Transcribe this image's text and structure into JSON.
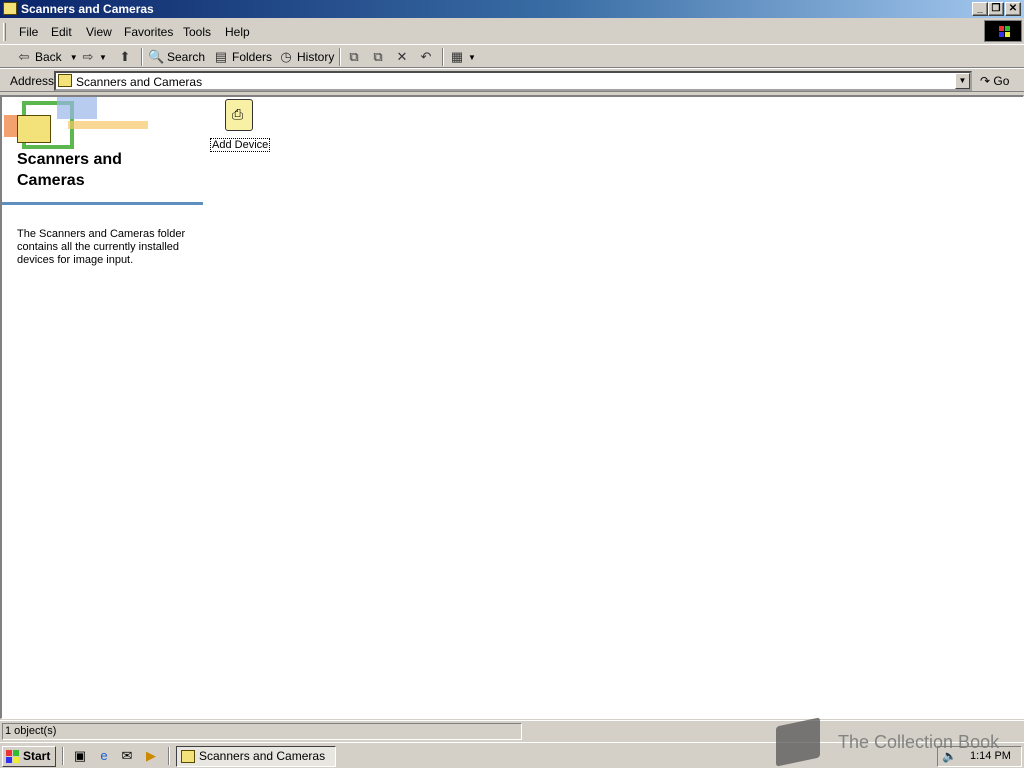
{
  "window": {
    "title": "Scanners and Cameras"
  },
  "menu": {
    "items": [
      "File",
      "Edit",
      "View",
      "Favorites",
      "Tools",
      "Help"
    ]
  },
  "toolbar": {
    "back": "Back",
    "search": "Search",
    "folders": "Folders",
    "history": "History"
  },
  "address": {
    "label": "Address",
    "value": "Scanners and Cameras",
    "go": "Go"
  },
  "left_panel": {
    "title_line1": "Scanners and",
    "title_line2": "Cameras",
    "description": "The Scanners and Cameras folder contains all the currently installed devices for image input."
  },
  "items": [
    {
      "label": "Add Device",
      "icon": "add-device-icon"
    }
  ],
  "status": {
    "text": "1 object(s)"
  },
  "taskbar": {
    "start": "Start",
    "task": "Scanners and Cameras",
    "clock": "1:14 PM"
  },
  "watermark": {
    "text": "The Collection Book"
  },
  "colors": {
    "title_start": "#0a246a",
    "title_end": "#a6caf0",
    "accent_rule": "#5f8fbf"
  }
}
